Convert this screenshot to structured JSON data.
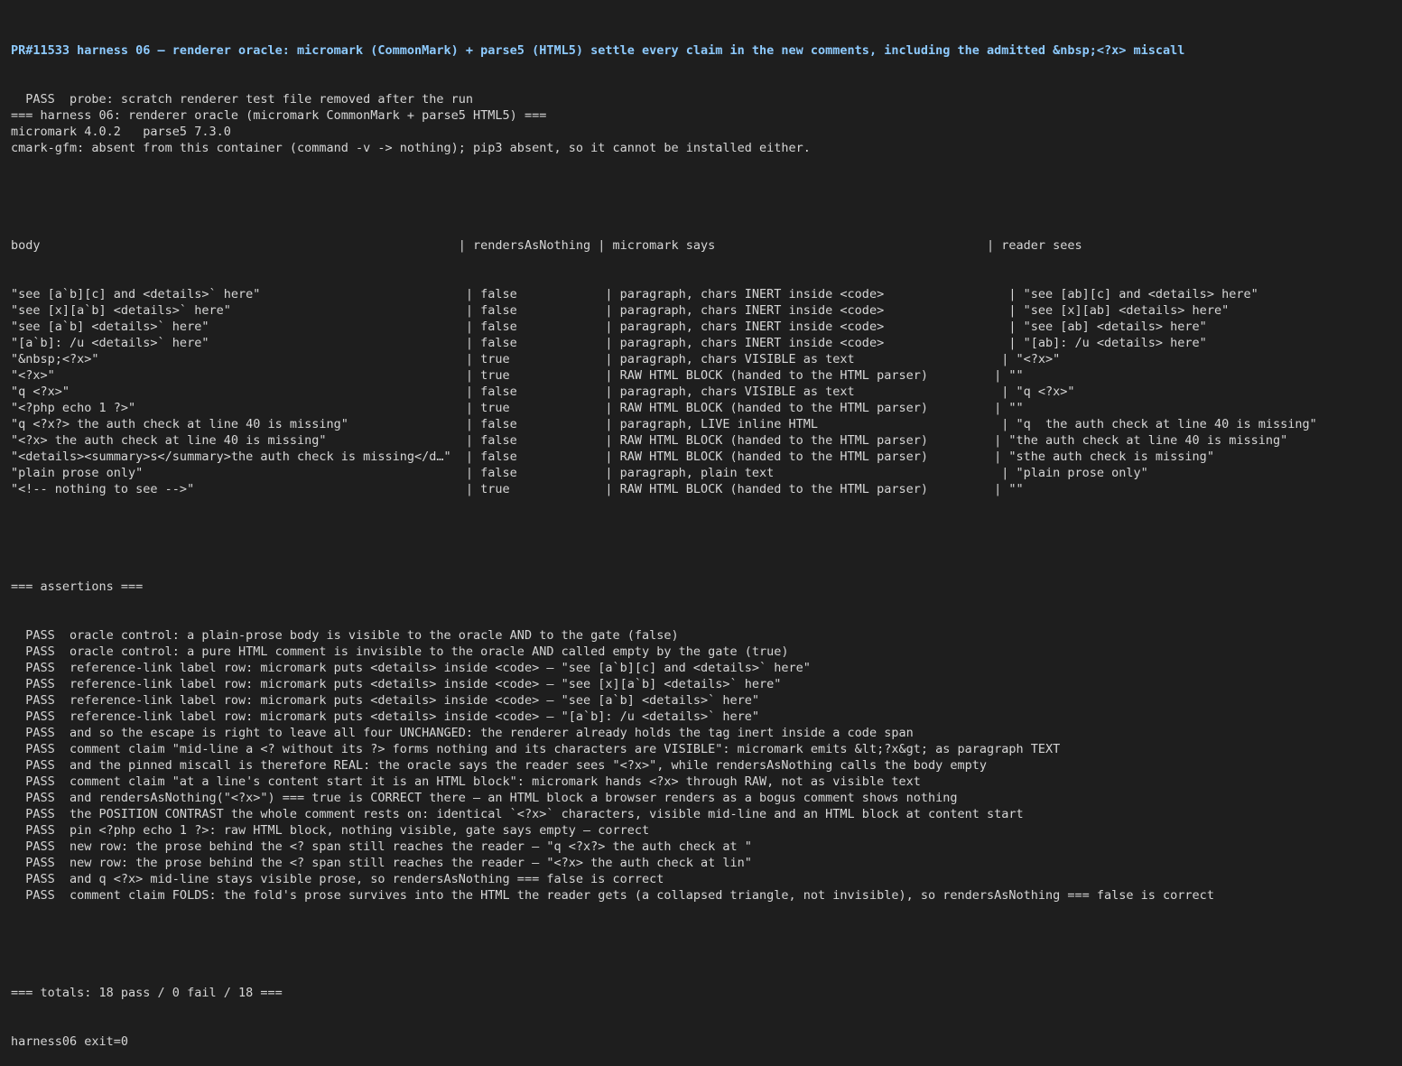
{
  "header": "PR#11533 harness 06 — renderer oracle: micromark (CommonMark) + parse5 (HTML5) settle every claim in the new comments, including the admitted &nbsp;<?x> miscall",
  "preamble": [
    "  PASS  probe: scratch renderer test file removed after the run",
    "=== harness 06: renderer oracle (micromark CommonMark + parse5 HTML5) ===",
    "micromark 4.0.2   parse5 7.3.0",
    "cmark-gfm: absent from this container (command -v -> nothing); pip3 absent, so it cannot be installed either."
  ],
  "table": {
    "header": "body                                                         | rendersAsNothing | micromark says                                     | reader sees",
    "rows": [
      "\"see [a`b][c] and <details>` here\"                            | false            | paragraph, chars INERT inside <code>                 | \"see [ab][c] and <details> here\"",
      "\"see [x][a`b] <details>` here\"                                | false            | paragraph, chars INERT inside <code>                 | \"see [x][ab] <details> here\"",
      "\"see [a`b] <details>` here\"                                   | false            | paragraph, chars INERT inside <code>                 | \"see [ab] <details> here\"",
      "\"[a`b]: /u <details>` here\"                                   | false            | paragraph, chars INERT inside <code>                 | \"[ab]: /u <details> here\"",
      "\"&nbsp;<?x>\"                                                  | true             | paragraph, chars VISIBLE as text                    | \"<?x>\"",
      "\"<?x>\"                                                        | true             | RAW HTML BLOCK (handed to the HTML parser)         | \"\"",
      "\"q <?x>\"                                                      | false            | paragraph, chars VISIBLE as text                    | \"q <?x>\"",
      "\"<?php echo 1 ?>\"                                             | true             | RAW HTML BLOCK (handed to the HTML parser)         | \"\"",
      "\"q <?x?> the auth check at line 40 is missing\"                | false            | paragraph, LIVE inline HTML                         | \"q  the auth check at line 40 is missing\"",
      "\"<?x> the auth check at line 40 is missing\"                   | false            | RAW HTML BLOCK (handed to the HTML parser)         | \"the auth check at line 40 is missing\"",
      "\"<details><summary>s</summary>the auth check is missing</d…\"  | false            | RAW HTML BLOCK (handed to the HTML parser)         | \"sthe auth check is missing\"",
      "\"plain prose only\"                                            | false            | paragraph, plain text                               | \"plain prose only\"",
      "\"<!-- nothing to see -->\"                                     | true             | RAW HTML BLOCK (handed to the HTML parser)         | \"\""
    ]
  },
  "assertions_header": "=== assertions ===",
  "assertions": [
    "  PASS  oracle control: a plain-prose body is visible to the oracle AND to the gate (false)",
    "  PASS  oracle control: a pure HTML comment is invisible to the oracle AND called empty by the gate (true)",
    "  PASS  reference-link label row: micromark puts <details> inside <code> — \"see [a`b][c] and <details>` here\"",
    "  PASS  reference-link label row: micromark puts <details> inside <code> — \"see [x][a`b] <details>` here\"",
    "  PASS  reference-link label row: micromark puts <details> inside <code> — \"see [a`b] <details>` here\"",
    "  PASS  reference-link label row: micromark puts <details> inside <code> — \"[a`b]: /u <details>` here\"",
    "  PASS  and so the escape is right to leave all four UNCHANGED: the renderer already holds the tag inert inside a code span",
    "  PASS  comment claim \"mid-line a <? without its ?> forms nothing and its characters are VISIBLE\": micromark emits &lt;?x&gt; as paragraph TEXT",
    "  PASS  and the pinned miscall is therefore REAL: the oracle says the reader sees \"<?x>\", while rendersAsNothing calls the body empty",
    "  PASS  comment claim \"at a line's content start it is an HTML block\": micromark hands <?x> through RAW, not as visible text",
    "  PASS  and rendersAsNothing(\"<?x>\") === true is CORRECT there — an HTML block a browser renders as a bogus comment shows nothing",
    "  PASS  the POSITION CONTRAST the whole comment rests on: identical `<?x>` characters, visible mid-line and an HTML block at content start",
    "  PASS  pin <?php echo 1 ?>: raw HTML block, nothing visible, gate says empty — correct",
    "  PASS  new row: the prose behind the <? span still reaches the reader — \"q <?x?> the auth check at \"",
    "  PASS  new row: the prose behind the <? span still reaches the reader — \"<?x> the auth check at lin\"",
    "  PASS  and q <?x> mid-line stays visible prose, so rendersAsNothing === false is correct",
    "  PASS  comment claim FOLDS: the fold's prose survives into the HTML the reader gets (a collapsed triangle, not invisible), so rendersAsNothing === false is correct"
  ],
  "totals": "=== totals: 18 pass / 0 fail / 18 ===",
  "exit": "harness06 exit=0"
}
